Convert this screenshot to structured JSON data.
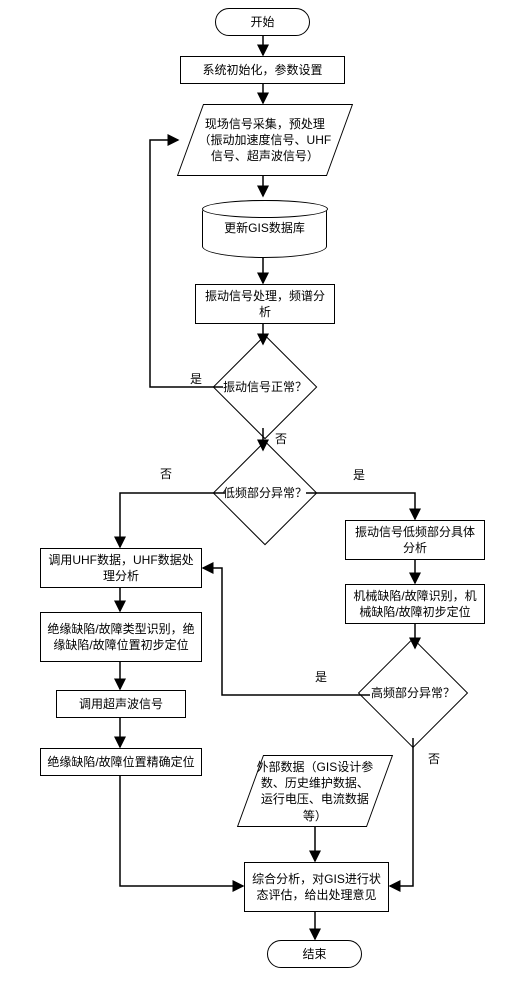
{
  "nodes": {
    "start": "开始",
    "init": "系统初始化，参数设置",
    "acquire": "现场信号采集，预处理（振动加速度信号、UHF信号、超声波信号）",
    "update_db": "更新GIS数据库",
    "vib_process": "振动信号处理，频谱分析",
    "vib_normal_q": "振动信号正常？",
    "low_freq_q": "低频部分异常？",
    "call_uhf": "调用UHF数据，UHF数据处理分析",
    "insul_id": "绝缘缺陷/故障类型识别，绝缘缺陷/故障位置初步定位",
    "call_ultra": "调用超声波信号",
    "insul_locate": "绝缘缺陷/故障位置精确定位",
    "vib_low_analyze": "振动信号低频部分具体分析",
    "mech_id": "机械缺陷/故障识别，机械缺陷/故障初步定位",
    "high_freq_q": "高频部分异常？",
    "ext_data": "外部数据（GIS设计参数、历史维护数据、运行电压、电流数据等）",
    "synth": "综合分析，对GIS进行状态评估，给出处理意见",
    "end": "结束"
  },
  "edges": {
    "yes": "是",
    "no": "否"
  }
}
